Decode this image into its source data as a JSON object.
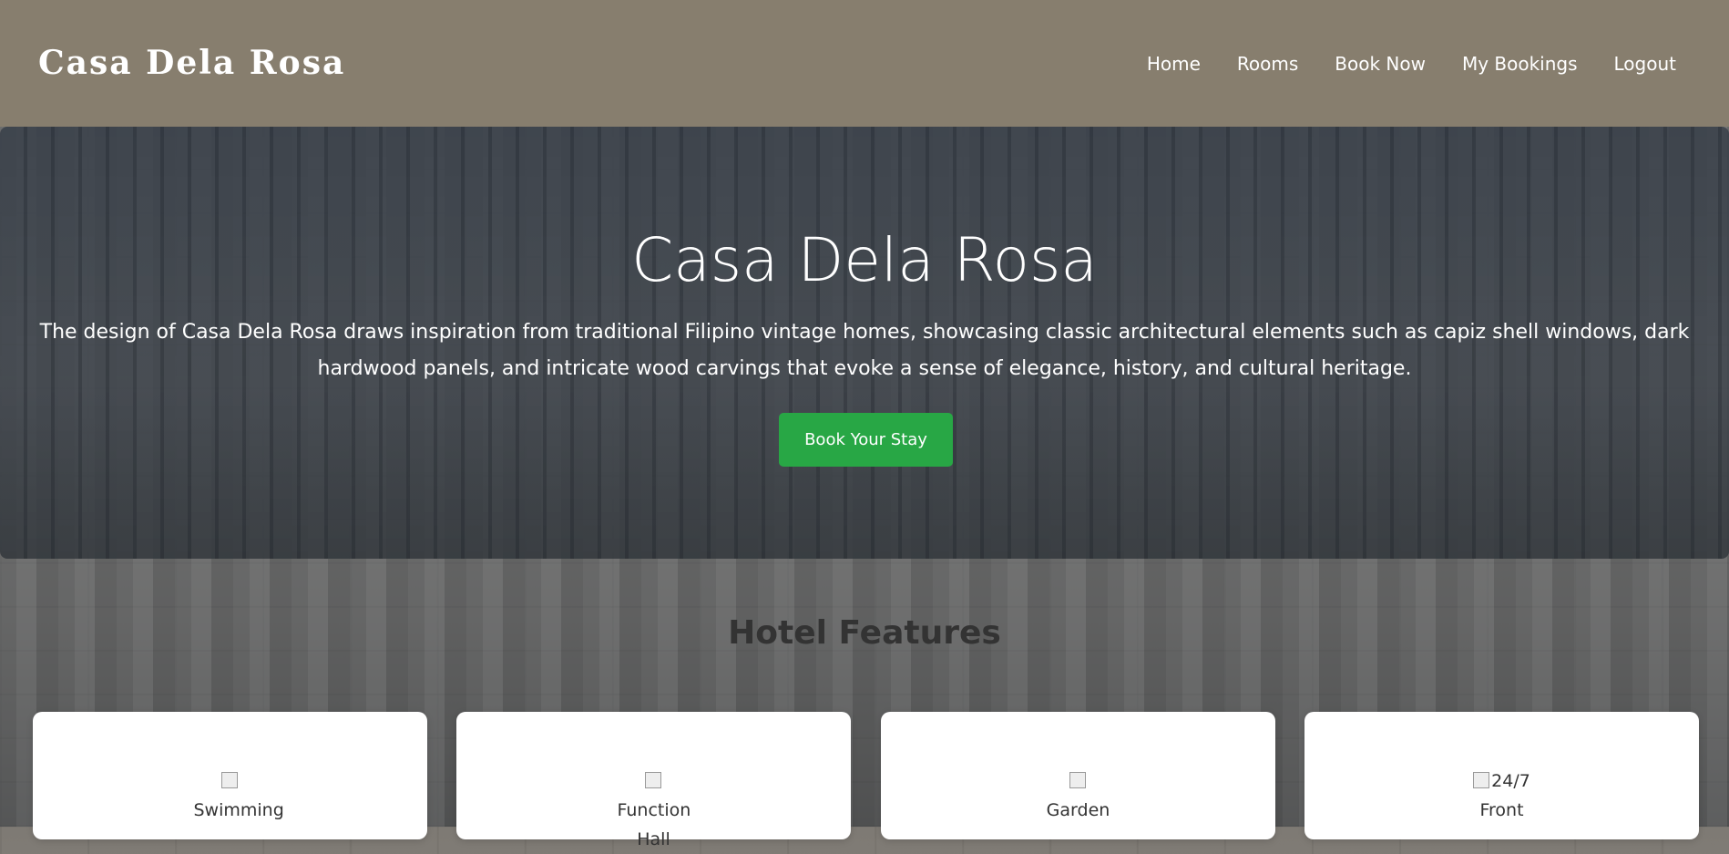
{
  "brand": "Casa Dela Rosa",
  "nav": {
    "items": [
      {
        "label": "Home"
      },
      {
        "label": "Rooms"
      },
      {
        "label": "Book Now"
      },
      {
        "label": "My Bookings"
      },
      {
        "label": "Logout"
      }
    ]
  },
  "hero": {
    "title": "Casa Dela Rosa",
    "text": "The design of Casa Dela Rosa draws inspiration from traditional Filipino vintage homes, showcasing classic architectural elements such as capiz shell windows, dark hardwood panels, and intricate wood carvings that evoke a sense of elegance, history, and cultural heritage.",
    "button": "Book Your Stay"
  },
  "features": {
    "title": "Hotel Features",
    "cards": [
      {
        "alt": "Swimming"
      },
      {
        "alt": "Function Hall"
      },
      {
        "alt": "Garden"
      },
      {
        "alt": "24/7 Front"
      }
    ]
  },
  "colors": {
    "navbar": "#877e6e",
    "button": "#28a745"
  }
}
